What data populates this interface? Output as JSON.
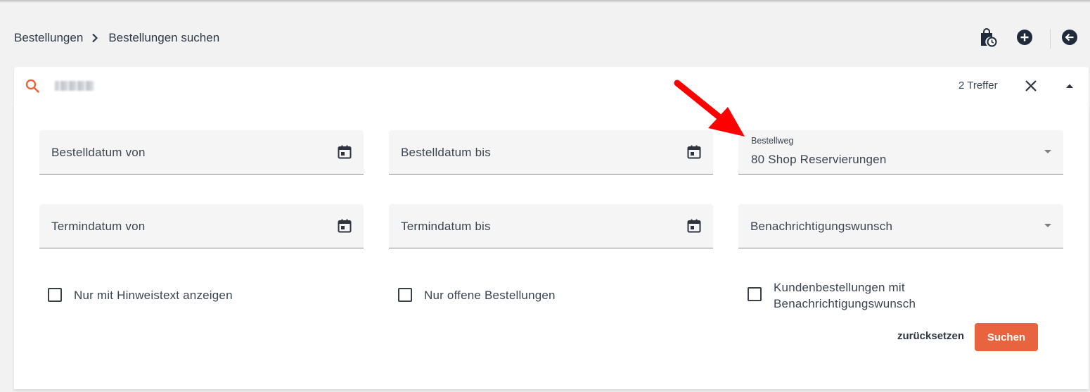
{
  "breadcrumb": {
    "root": "Bestellungen",
    "current": "Bestellungen suchen"
  },
  "toolbar": {
    "icons": [
      "shopping-bag-clock-icon",
      "add-circle-icon",
      "back-arrow-circle-icon"
    ]
  },
  "search": {
    "query": "",
    "hits": "2 Treffer"
  },
  "filters": {
    "order_date_from": "Bestelldatum von",
    "order_date_to": "Bestelldatum bis",
    "order_channel_label": "Bestellweg",
    "order_channel_value": "80 Shop Reservierungen",
    "appointment_date_from": "Termindatum von",
    "appointment_date_to": "Termindatum bis",
    "notification_wish": "Benachrichtigungswunsch"
  },
  "checkboxes": {
    "only_with_note": "Nur mit Hinweistext anzeigen",
    "only_open": "Nur offene Bestellungen",
    "customer_orders_line1": "Kundenbestellungen mit",
    "customer_orders_line2": "Benachrichtigungswunsch"
  },
  "buttons": {
    "reset": "zurücksetzen",
    "search": "Suchen"
  },
  "colors": {
    "accent": "#e8643e",
    "icon_dark": "#1f2a3a",
    "annotation_arrow": "#ff0000",
    "background": "#f2f2f2"
  }
}
